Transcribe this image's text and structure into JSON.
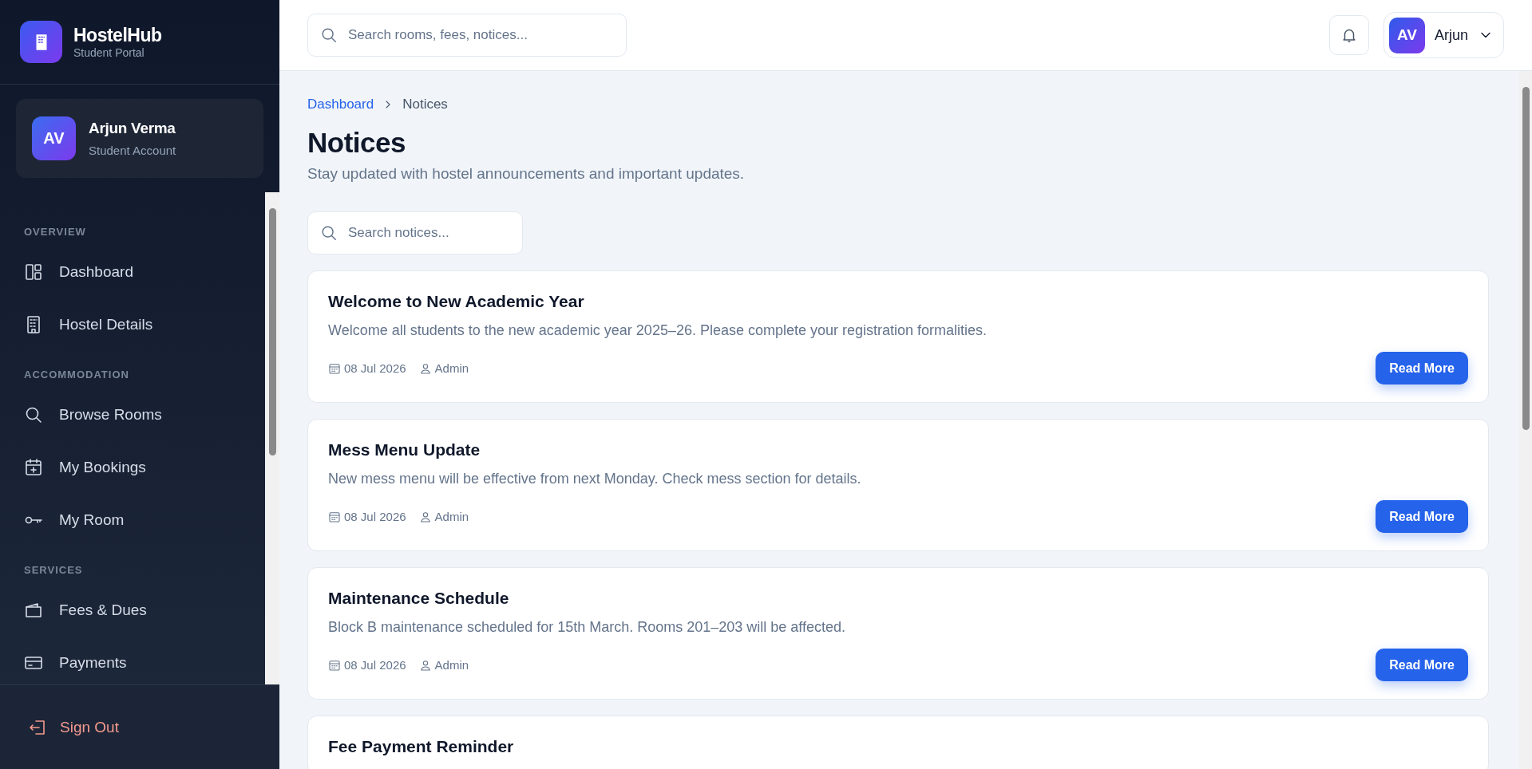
{
  "brand": {
    "name": "HostelHub",
    "subtitle": "Student Portal"
  },
  "profile": {
    "initials": "AV",
    "name": "Arjun Verma",
    "role": "Student Account"
  },
  "nav_sections": [
    {
      "label": "OVERVIEW",
      "items": [
        {
          "label": "Dashboard"
        },
        {
          "label": "Hostel Details"
        }
      ]
    },
    {
      "label": "ACCOMMODATION",
      "items": [
        {
          "label": "Browse Rooms"
        },
        {
          "label": "My Bookings"
        },
        {
          "label": "My Room"
        }
      ]
    },
    {
      "label": "SERVICES",
      "items": [
        {
          "label": "Fees & Dues"
        },
        {
          "label": "Payments"
        }
      ]
    }
  ],
  "sign_out": "Sign Out",
  "header": {
    "search_placeholder": "Search rooms, fees, notices...",
    "user_initials": "AV",
    "user_name": "Arjun"
  },
  "breadcrumb": [
    "Dashboard",
    "Notices"
  ],
  "page_title": "Notices",
  "page_subtitle": "Stay updated with hostel announcements and important updates.",
  "notice_search_placeholder": "Search notices...",
  "notices": [
    {
      "title": "Welcome to New Academic Year",
      "body": "Welcome all students to the new academic year 2025–26. Please complete your registration formalities.",
      "date": "08 Jul 2026",
      "author": "Admin",
      "action": "Read More"
    },
    {
      "title": "Mess Menu Update",
      "body": "New mess menu will be effective from next Monday. Check mess section for details.",
      "date": "08 Jul 2026",
      "author": "Admin",
      "action": "Read More"
    },
    {
      "title": "Maintenance Schedule",
      "body": "Block B maintenance scheduled for 15th March. Rooms 201–203 will be affected.",
      "date": "08 Jul 2026",
      "author": "Admin",
      "action": "Read More"
    },
    {
      "title": "Fee Payment Reminder"
    }
  ]
}
